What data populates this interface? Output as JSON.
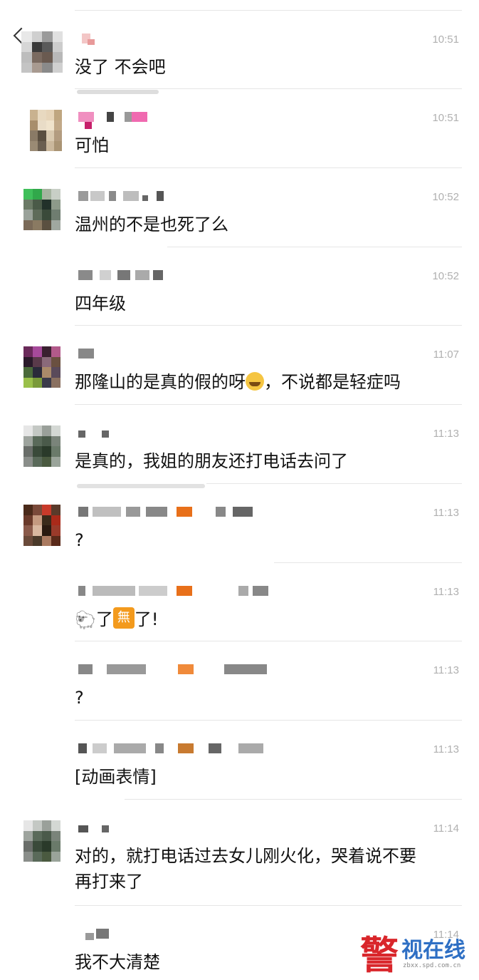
{
  "messages": [
    {
      "time": "10:51",
      "text": "没了 不会吧",
      "has_avatar": true
    },
    {
      "time": "10:51",
      "text": "可怕",
      "has_avatar": true
    },
    {
      "time": "10:52",
      "text": "温州的不是也死了么",
      "has_avatar": true
    },
    {
      "time": "10:52",
      "text": "四年级",
      "has_avatar": false
    },
    {
      "time": "11:07",
      "text_before": "那隆山的是真的假的呀",
      "emoji": "face-with-tears-of-joy",
      "text_after": "，不说都是轻症吗",
      "has_avatar": true
    },
    {
      "time": "11:13",
      "text": "是真的，我姐的朋友还打电话去问了",
      "has_avatar": true
    },
    {
      "time": "11:13",
      "text": "?",
      "has_avatar": true
    },
    {
      "time": "11:13",
      "emoji_sheep": "🐑",
      "text_mid": "了",
      "badge": "無",
      "text_after": "了!",
      "has_avatar": false
    },
    {
      "time": "11:13",
      "text": "?",
      "has_avatar": false
    },
    {
      "time": "11:13",
      "text": "[动画表情]",
      "has_avatar": false
    },
    {
      "time": "11:14",
      "text": "对的，就打电话过去女儿刚火化，哭着说不要\n再打来了",
      "has_avatar": true
    },
    {
      "time": "11:14",
      "text": "我不大清楚",
      "has_avatar": false
    }
  ],
  "watermark": {
    "char": "警",
    "text": "视在线",
    "url": "zbxx.spd.com.cn"
  },
  "colors": {
    "time": "#b0b0b0",
    "divider": "#e6e6e6",
    "text": "#111111",
    "watermark_red": "#d9262b",
    "watermark_blue": "#2e6fc4"
  }
}
